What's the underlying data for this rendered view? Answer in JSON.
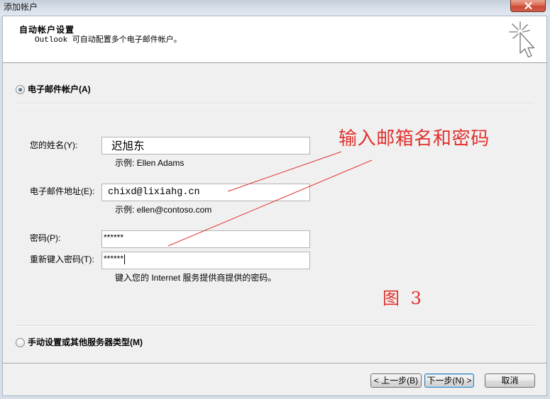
{
  "window": {
    "title": "添加帐户",
    "close_icon": "close-icon"
  },
  "header": {
    "title": "自动帐户设置",
    "subtitle": "Outlook 可自动配置多个电子邮件帐户。",
    "icon": "auto-setup-cursor-icon"
  },
  "email_account": {
    "label": "电子邮件帐户(A)",
    "selected": true,
    "name": {
      "label": "您的姓名(Y):",
      "value": "迟旭东",
      "hint": "示例: Ellen Adams"
    },
    "email": {
      "label": "电子邮件地址(E):",
      "value": "chixd@lixiahg.cn",
      "hint": "示例: ellen@contoso.com"
    },
    "password": {
      "label": "密码(P):",
      "value": "******"
    },
    "confirm_password": {
      "label": "重新键入密码(T):",
      "value": "******",
      "hint": "键入您的 Internet 服务提供商提供的密码。"
    }
  },
  "manual_setup": {
    "label": "手动设置或其他服务器类型(M)",
    "selected": false
  },
  "buttons": {
    "back": "< 上一步(B)",
    "next": "下一步(N) >",
    "cancel": "取消"
  },
  "annotation": {
    "text": "输入邮箱名和密码",
    "figure_label": "图 3"
  },
  "colors": {
    "annotation": "#e0302d",
    "dialog_background": "#f0f0f0",
    "header_background": "#ffffff",
    "default_button_border": "#3c7fb1",
    "close_button": "#c94a36"
  }
}
